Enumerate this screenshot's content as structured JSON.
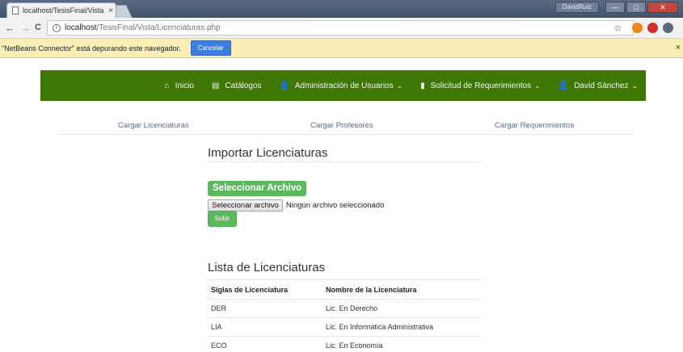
{
  "browser": {
    "tab_title": "localhost/TesisFinal/Vista",
    "tab_close": "×",
    "url_host": "localhost",
    "url_path": "/TesisFinal/Vista/Licenciaturas.php",
    "profile_name": "DavidRuiz",
    "back": "←",
    "forward": "→",
    "reload": "C",
    "star": "☆",
    "win_min": "—",
    "win_max": "□",
    "win_close": "✕",
    "extensions": [
      {
        "name": "extension-orange-icon",
        "color": "#e8891c"
      },
      {
        "name": "extension-red-icon",
        "color": "#d62d2d"
      },
      {
        "name": "extension-gray-icon",
        "color": "#5a6b80"
      }
    ]
  },
  "infobar": {
    "message": "\"NetBeans Connector\" está depurando este navegador.",
    "cancel_label": "Cancelar",
    "close": "×"
  },
  "navbar": {
    "color": "#3f7705",
    "items": [
      {
        "icon": "home-icon",
        "glyph": "⌂",
        "label": "Inicio",
        "caret": ""
      },
      {
        "icon": "list-icon",
        "glyph": "▤",
        "label": "Catálogos",
        "caret": ""
      },
      {
        "icon": "user-icon",
        "glyph": "👤",
        "label": "Administración de Usuarios",
        "caret": "⌄"
      },
      {
        "icon": "file-icon",
        "glyph": "▮",
        "label": "Solicitud de Requerimientos",
        "caret": "⌄"
      },
      {
        "icon": "user-icon",
        "glyph": "👤",
        "label": "David Sánchez",
        "caret": "⌄"
      }
    ]
  },
  "subnav": {
    "links": [
      "Cargar Licenciaturas",
      "Cargar Profesores",
      "Cargar Requerimientos"
    ]
  },
  "import": {
    "title": "Importar Licenciaturas",
    "select_header": "Seleccionar Archivo",
    "file_button": "Seleccionar archivo",
    "file_status": "Ningún archivo seleccionado",
    "submit_label": "Subir"
  },
  "list": {
    "title": "Lista de Licenciaturas",
    "columns": [
      "Siglas de Licenciatura",
      "Nombre de la Licenciatura"
    ],
    "rows": [
      [
        "DER",
        "Lic. En Derecho"
      ],
      [
        "LIA",
        "Lic. En Informática Administrativa"
      ],
      [
        "ECO",
        "Lic. En Economía"
      ]
    ]
  }
}
